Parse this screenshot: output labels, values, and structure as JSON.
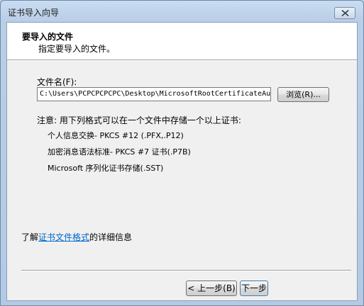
{
  "window": {
    "title": "证书导入向导"
  },
  "header": {
    "title": "要导入的文件",
    "subtitle": "指定要导入的文件。"
  },
  "file": {
    "label": "文件名(F):",
    "value": "C:\\Users\\PCPCPCPCPC\\Desktop\\MicrosoftRootCertificateAu",
    "browse_label": "浏览(R)..."
  },
  "formats": {
    "note": "注意: 用下列格式可以在一个文件中存储一个以上证书:",
    "items": [
      "个人信息交换- PKCS #12 (.PFX,.P12)",
      "加密消息语法标准- PKCS #7 证书(.P7B)",
      "Microsoft 序列化证书存储(.SST)"
    ]
  },
  "learn_more": {
    "prefix": "了解",
    "link": "证书文件格式",
    "suffix": "的详细信息"
  },
  "buttons": {
    "back": "< 上一步(B)",
    "next": "下一步"
  },
  "icons": {
    "close": "close-icon"
  }
}
